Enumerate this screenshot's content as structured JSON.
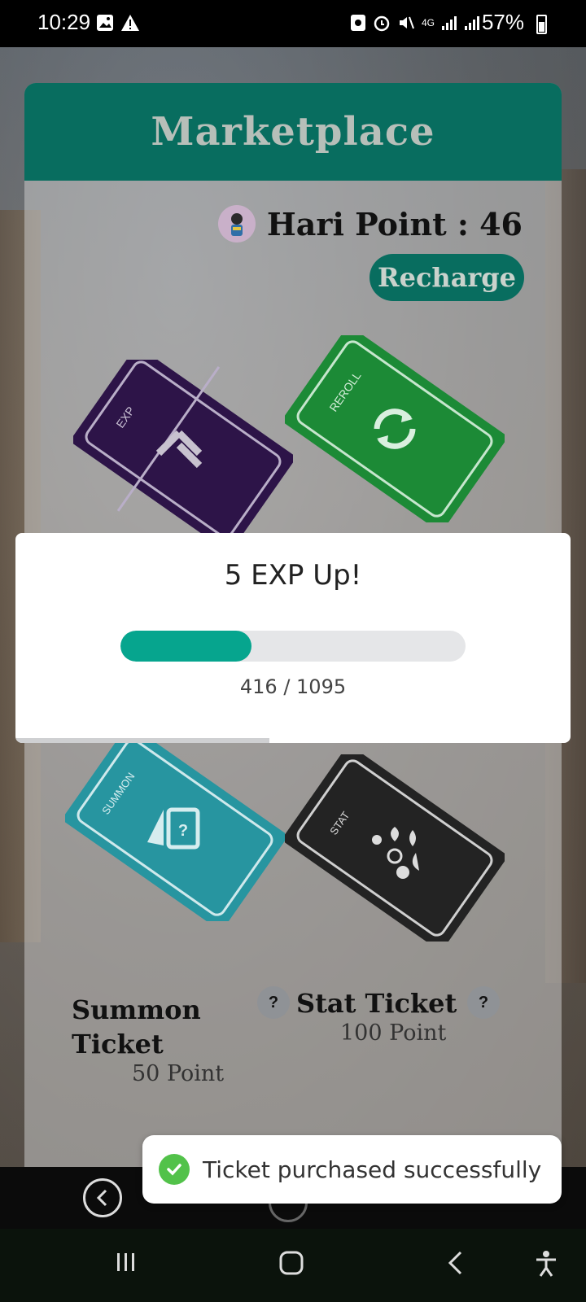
{
  "status_bar": {
    "time": "10:29",
    "battery": "57%",
    "network": "4G"
  },
  "marketplace": {
    "title": "Marketplace",
    "points_label": "Hari Point : 46",
    "recharge_label": "Recharge",
    "tickets": [
      {
        "name": "EXP",
        "color": "#3a1e5c",
        "icon": "exp-chevron-icon"
      },
      {
        "name": "REROLL",
        "color": "#1f8a3a",
        "icon": "reroll-icon"
      },
      {
        "name": "SUMMON",
        "color": "#2a9aa2",
        "icon": "summon-card-icon",
        "caption": "Summon Ticket",
        "price": "50 Point"
      },
      {
        "name": "STAT",
        "color": "#252525",
        "icon": "stat-elements-icon",
        "caption": "Stat Ticket",
        "price": "100 Point"
      }
    ],
    "help_glyph": "?"
  },
  "modal": {
    "title": "5 EXP Up!",
    "progress_text": "416 / 1095",
    "progress_value": 416,
    "progress_max": 1095,
    "accent": "#06a58e"
  },
  "toast": {
    "message": "Ticket purchased successfully",
    "icon": "check-circle-icon"
  },
  "colors": {
    "brand": "#086d5f",
    "success": "#52c24a"
  }
}
